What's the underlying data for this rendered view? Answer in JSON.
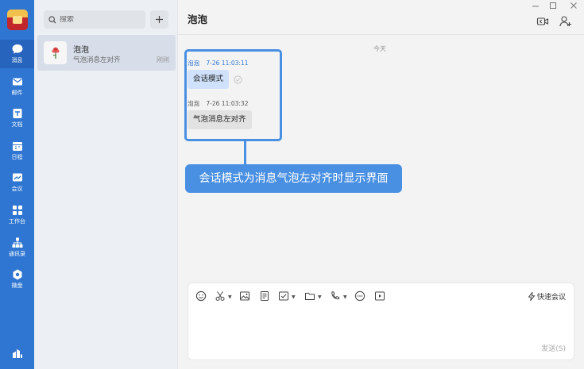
{
  "nav": {
    "items": [
      {
        "label": "消息",
        "icon": "chat-bubble-icon",
        "active": true
      },
      {
        "label": "邮件",
        "icon": "mail-icon"
      },
      {
        "label": "文档",
        "icon": "document-icon"
      },
      {
        "label": "日程",
        "icon": "calendar-icon"
      },
      {
        "label": "会议",
        "icon": "meeting-icon"
      },
      {
        "label": "工作台",
        "icon": "workbench-icon"
      },
      {
        "label": "通讯录",
        "icon": "contacts-icon"
      },
      {
        "label": "微盘",
        "icon": "cloud-drive-icon"
      }
    ]
  },
  "search": {
    "placeholder": "搜索"
  },
  "conversation": {
    "name": "泡泡",
    "preview": "气泡消息左对齐",
    "time": "刚刚"
  },
  "chat": {
    "title": "泡泡",
    "day_label": "今天",
    "messages": [
      {
        "sender": "泡泡",
        "time": "7-26 11:03:11",
        "text": "会话模式",
        "style": "blue"
      },
      {
        "sender": "泡泡",
        "time": "7-26 11:03:32",
        "text": "气泡消息左对齐",
        "style": "grey"
      }
    ],
    "callout": "会话模式为消息气泡左对齐时显示界面"
  },
  "composer": {
    "quick_meeting": "快速会议",
    "send": "发送(S)"
  },
  "colors": {
    "nav_bg": "#2f76d2",
    "accent": "#4a90e2",
    "bubble_blue": "#cfe1fb",
    "bubble_grey": "#e2e2e2"
  }
}
